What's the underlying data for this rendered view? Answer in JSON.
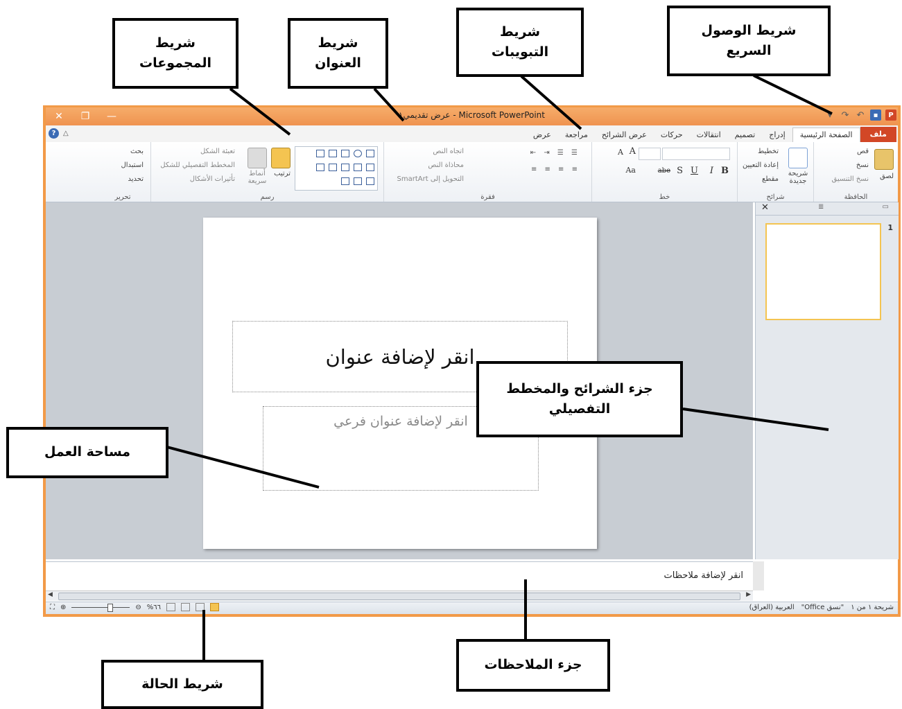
{
  "window": {
    "title": "عرض تقديمي١ - Microsoft PowerPoint",
    "controls": {
      "close": "✕",
      "restore": "❐",
      "minimize": "—"
    },
    "app_icon_letter": "P",
    "frame_color": "#f29a48"
  },
  "tabs": [
    {
      "label": "ملف",
      "active": false,
      "file": true
    },
    {
      "label": "الصفحة الرئيسية",
      "active": true
    },
    {
      "label": "إدراج"
    },
    {
      "label": "تصميم"
    },
    {
      "label": "انتقالات"
    },
    {
      "label": "حركات"
    },
    {
      "label": "عرض الشرائح"
    },
    {
      "label": "مراجعة"
    },
    {
      "label": "عرض"
    }
  ],
  "ribbon": {
    "clipboard": {
      "label": "الحافظة",
      "paste": "لصق",
      "cut": "قص",
      "copy": "نسخ",
      "format_painter": "نسخ التنسيق"
    },
    "slides": {
      "label": "شرائح",
      "new_slide": "شريحة جديدة",
      "layout": "تخطيط",
      "reset": "إعادة التعيين",
      "section": "مقطع"
    },
    "font": {
      "label": "خط",
      "bold": "B",
      "italic": "I",
      "underline": "U",
      "strike": "S",
      "spacing": "abe",
      "case": "Aa",
      "grow": "A",
      "shrink": "A"
    },
    "paragraph": {
      "label": "فقرة",
      "text_direction": "اتجاه النص",
      "align_text": "محاذاة النص",
      "smartart": "التحويل إلى SmartArt"
    },
    "drawing": {
      "label": "رسم",
      "arrange": "ترتيب",
      "quick_styles": "أنماط سريعة",
      "shape_fill": "تعبئة الشكل",
      "shape_outline": "المخطط التفصيلي للشكل",
      "shape_effects": "تأثيرات الأشكال"
    },
    "editing": {
      "label": "تحرير",
      "find": "بحث",
      "replace": "استبدال",
      "select": "تحديد"
    }
  },
  "slide": {
    "title_placeholder": "انقر لإضافة عنوان",
    "subtitle_placeholder": "انقر لإضافة عنوان فرعي"
  },
  "slides_pane": {
    "close": "✕",
    "thumbnail_number": "1"
  },
  "notes": {
    "placeholder": "انقر لإضافة ملاحظات"
  },
  "status": {
    "slide_info": "شريحة ١ من ١",
    "theme": "\"نسق Office\"",
    "language": "العربية (العراق)",
    "zoom": "%٦٦"
  },
  "callouts": {
    "quick_access": "شريط الوصول\nالسريع",
    "tabs_bar": "شريط\nالتبويبات",
    "title_bar": "شريط\nالعنوان",
    "groups_bar": "شريط\nالمجموعات",
    "slides_outline_pane": "جزء الشرائح   والمخطط\nالتفصيلي",
    "workspace": "مساحة العمل",
    "status_bar": "شريط الحالة",
    "notes_pane": "جزء الملاحظات"
  }
}
